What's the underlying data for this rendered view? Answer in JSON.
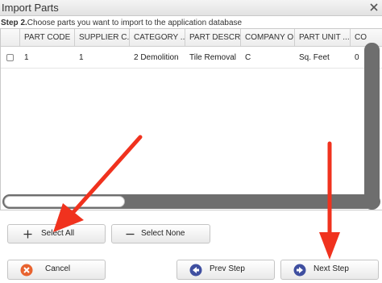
{
  "window": {
    "title": "Import Parts"
  },
  "step": {
    "label": "Step 2.",
    "text": "Choose parts you want to import to the application database"
  },
  "table": {
    "columns": [
      "PART CODE",
      "SUPPLIER C...",
      "CATEGORY ...",
      "PART DESCR...",
      "COMPANY O...",
      "PART UNIT ...",
      "CO"
    ],
    "rows": [
      {
        "checked": false,
        "cells": [
          "1",
          "1",
          "2 Demolition",
          "Tile Removal",
          "C",
          "Sq. Feet",
          "0"
        ]
      }
    ]
  },
  "buttons": {
    "select_all": "Select All",
    "select_none": "Select None",
    "cancel": "Cancel",
    "prev": "Prev Step",
    "next": "Next Step"
  },
  "colors": {
    "cancel_icon": "#e8632f",
    "nav_icon": "#3f4fa0",
    "annotation_arrow": "#f0321e"
  },
  "icons": {
    "close": "close-icon",
    "select_all": "plus-icon",
    "select_none": "minus-icon",
    "cancel": "cancel-circle-icon",
    "prev": "arrow-left-circle-icon",
    "next": "arrow-right-circle-icon"
  }
}
